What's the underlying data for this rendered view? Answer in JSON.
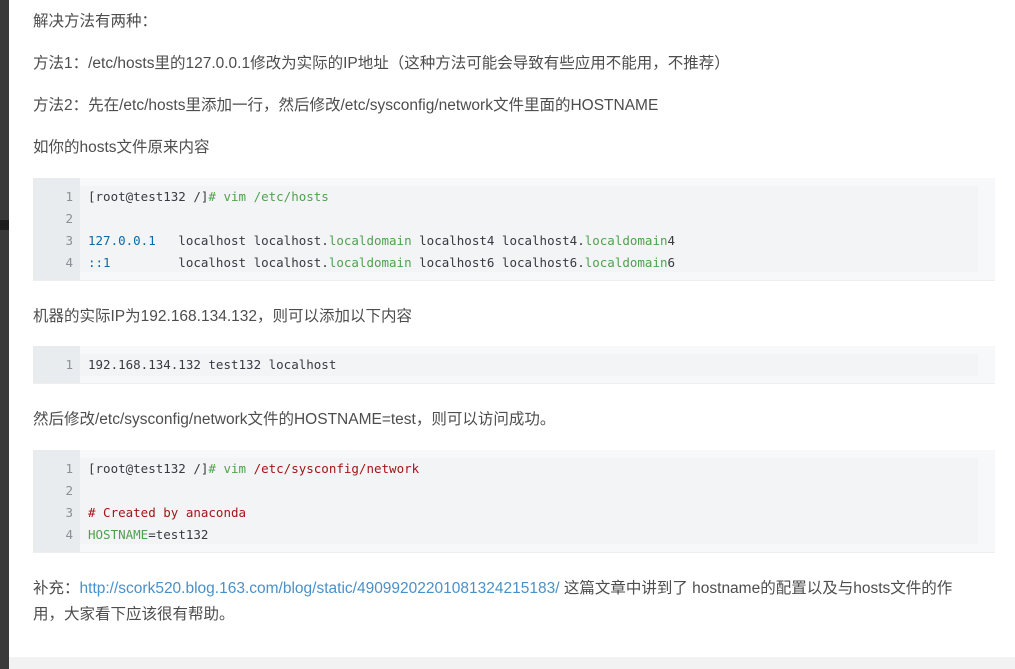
{
  "intro": "解决方法有两种：",
  "method1": "方法1：/etc/hosts里的127.0.0.1修改为实际的IP地址（这种方法可能会导致有些应用不能用，不推荐）",
  "method2": "方法2：先在/etc/hosts里添加一行，然后修改/etc/sysconfig/network文件里面的HOSTNAME",
  "original_hosts_intro": "如你的hosts文件原来内容",
  "block1": {
    "line_numbers": [
      "1",
      "2",
      "3",
      "4"
    ],
    "l1_prompt": "[root@test132 /]",
    "l1_cmd": "# vim /etc/hosts",
    "l3_ip": "127.0.0.1",
    "l3_a": "   localhost localhost.",
    "l3_b": "localdomain",
    "l3_c": " localhost4 localhost4.",
    "l3_d": "localdomain",
    "l3_e": "4",
    "l4_ip": "::1",
    "l4_a": "         localhost localhost.",
    "l4_b": "localdomain",
    "l4_c": " localhost6 localhost6.",
    "l4_d": "localdomain",
    "l4_e": "6"
  },
  "machine_ip_text": "机器的实际IP为192.168.134.132，则可以添加以下内容",
  "block2": {
    "line_numbers": [
      "1"
    ],
    "l1": "192.168.134.132 test132 localhost"
  },
  "network_text": "然后修改/etc/sysconfig/network文件的HOSTNAME=test，则可以访问成功。",
  "block3": {
    "line_numbers": [
      "1",
      "2",
      "3",
      "4"
    ],
    "l1_prompt": "[root@test132 /]",
    "l1_cmd": "# vim ",
    "l1_path": "/etc/sysconfig/network",
    "l3_comment": "# Created by anaconda",
    "l4_key": "HOSTNAME",
    "l4_val": "=test132"
  },
  "supplement_prefix": "补充：",
  "supplement_link": "http://scork520.blog.163.com/blog/static/4909920220108132421518​3/",
  "supplement_rest_line1": " 这篇文章中讲到了 hostname的配置以及与hosts文件的作",
  "supplement_line2": "用，大家看下应该很有帮助。"
}
